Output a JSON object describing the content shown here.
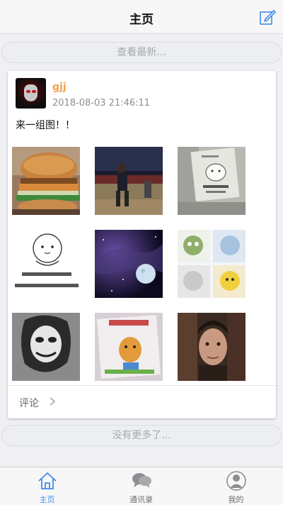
{
  "header": {
    "title": "主页"
  },
  "feed": {
    "refresh_label": "查看最新...",
    "end_label": "没有更多了..."
  },
  "post": {
    "username": "gjj",
    "timestamp": "2018-08-03 21:46:11",
    "content": "来一组图！！",
    "image_count": 9,
    "comment_label": "评论"
  },
  "tabs": [
    {
      "label": "主页",
      "icon": "home-icon",
      "active": true
    },
    {
      "label": "通讯录",
      "icon": "chat-bubbles-icon",
      "active": false
    },
    {
      "label": "我的",
      "icon": "person-icon",
      "active": false
    }
  ],
  "colors": {
    "accent": "#3f8ce8",
    "username": "#f0a04b"
  }
}
